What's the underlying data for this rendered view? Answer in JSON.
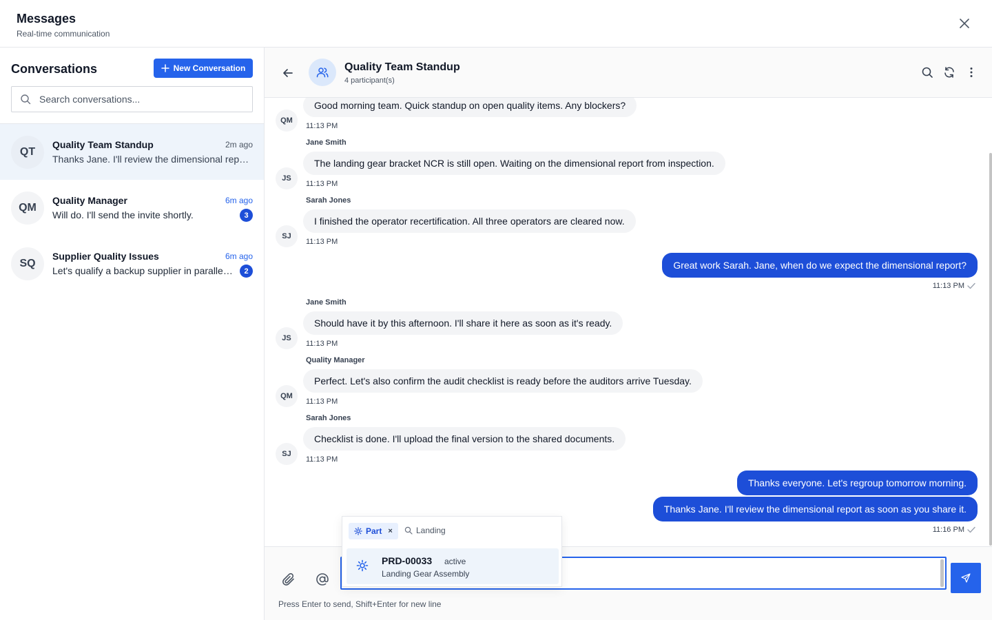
{
  "header": {
    "title": "Messages",
    "subtitle": "Real-time communication"
  },
  "sidebar": {
    "title": "Conversations",
    "new_button": "New Conversation",
    "search_placeholder": "Search conversations...",
    "conversations": [
      {
        "initials": "QT",
        "name": "Quality Team Standup",
        "time": "2m ago",
        "preview": "Thanks Jane. I'll review the dimensional report as soon as you share it.",
        "unread": ""
      },
      {
        "initials": "QM",
        "name": "Quality Manager",
        "time": "6m ago",
        "preview": "Will do. I'll send the invite shortly.",
        "unread": "3"
      },
      {
        "initials": "SQ",
        "name": "Supplier Quality Issues",
        "time": "6m ago",
        "preview": "Let's qualify a backup supplier in parallel. Can you start the process?",
        "unread": "2"
      }
    ]
  },
  "chat": {
    "title": "Quality Team Standup",
    "participants": "4 participant(s)",
    "messages": [
      {
        "sender": "",
        "initials": "QM",
        "text": "Good morning team. Quick standup on open quality items. Any blockers?",
        "time": "11:13 PM"
      },
      {
        "sender": "Jane Smith",
        "initials": "JS",
        "text": "The landing gear bracket NCR is still open. Waiting on the dimensional report from inspection.",
        "time": "11:13 PM"
      },
      {
        "sender": "Sarah Jones",
        "initials": "SJ",
        "text": "I finished the operator recertification. All three operators are cleared now.",
        "time": "11:13 PM"
      },
      {
        "sender": "Me",
        "text": "Great work Sarah. Jane, when do we expect the dimensional report?",
        "time": "11:13 PM"
      },
      {
        "sender": "Jane Smith",
        "initials": "JS",
        "text": "Should have it by this afternoon. I'll share it here as soon as it's ready.",
        "time": "11:13 PM"
      },
      {
        "sender": "Quality Manager",
        "initials": "QM",
        "text": "Perfect. Let's also confirm the audit checklist is ready before the auditors arrive Tuesday.",
        "time": "11:13 PM"
      },
      {
        "sender": "Sarah Jones",
        "initials": "SJ",
        "text": "Checklist is done. I'll upload the final version to the shared documents.",
        "time": "11:13 PM"
      },
      {
        "sender": "Me",
        "text": "Thanks everyone. Let's regroup tomorrow morning.",
        "time": ""
      },
      {
        "sender": "Me",
        "text": "Thanks Jane. I'll review the dimensional report as soon as you share it.",
        "time": "11:16 PM"
      }
    ]
  },
  "composer": {
    "value": "",
    "hint": "Press Enter to send, Shift+Enter for new line"
  },
  "mention_popup": {
    "filter_chip": "Part",
    "filter_remove": "×",
    "search_value": "Landing",
    "results": [
      {
        "id": "PRD-00033",
        "status": "active",
        "name": "Landing Gear Assembly"
      }
    ]
  },
  "colors": {
    "primary": "#2563eb",
    "outgoing_bubble": "#1d4ed8",
    "incoming_bubble": "#f3f4f6",
    "selected_row": "#eef4fb"
  },
  "icons": [
    "close-icon",
    "plus-icon",
    "search-icon",
    "back-arrow-icon",
    "users-icon",
    "refresh-icon",
    "more-vertical-icon",
    "paperclip-icon",
    "at-sign-icon",
    "send-icon",
    "gear-icon",
    "check-icon"
  ]
}
